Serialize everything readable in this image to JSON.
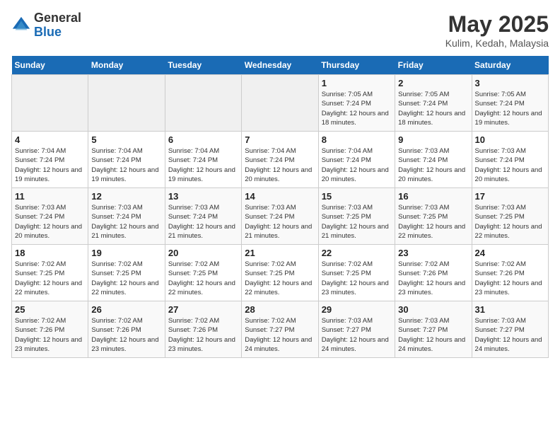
{
  "logo": {
    "general": "General",
    "blue": "Blue"
  },
  "title": "May 2025",
  "subtitle": "Kulim, Kedah, Malaysia",
  "headers": [
    "Sunday",
    "Monday",
    "Tuesday",
    "Wednesday",
    "Thursday",
    "Friday",
    "Saturday"
  ],
  "weeks": [
    [
      {
        "day": "",
        "sunrise": "",
        "sunset": "",
        "daylight": ""
      },
      {
        "day": "",
        "sunrise": "",
        "sunset": "",
        "daylight": ""
      },
      {
        "day": "",
        "sunrise": "",
        "sunset": "",
        "daylight": ""
      },
      {
        "day": "",
        "sunrise": "",
        "sunset": "",
        "daylight": ""
      },
      {
        "day": "1",
        "sunrise": "Sunrise: 7:05 AM",
        "sunset": "Sunset: 7:24 PM",
        "daylight": "Daylight: 12 hours and 18 minutes."
      },
      {
        "day": "2",
        "sunrise": "Sunrise: 7:05 AM",
        "sunset": "Sunset: 7:24 PM",
        "daylight": "Daylight: 12 hours and 18 minutes."
      },
      {
        "day": "3",
        "sunrise": "Sunrise: 7:05 AM",
        "sunset": "Sunset: 7:24 PM",
        "daylight": "Daylight: 12 hours and 19 minutes."
      }
    ],
    [
      {
        "day": "4",
        "sunrise": "Sunrise: 7:04 AM",
        "sunset": "Sunset: 7:24 PM",
        "daylight": "Daylight: 12 hours and 19 minutes."
      },
      {
        "day": "5",
        "sunrise": "Sunrise: 7:04 AM",
        "sunset": "Sunset: 7:24 PM",
        "daylight": "Daylight: 12 hours and 19 minutes."
      },
      {
        "day": "6",
        "sunrise": "Sunrise: 7:04 AM",
        "sunset": "Sunset: 7:24 PM",
        "daylight": "Daylight: 12 hours and 19 minutes."
      },
      {
        "day": "7",
        "sunrise": "Sunrise: 7:04 AM",
        "sunset": "Sunset: 7:24 PM",
        "daylight": "Daylight: 12 hours and 20 minutes."
      },
      {
        "day": "8",
        "sunrise": "Sunrise: 7:04 AM",
        "sunset": "Sunset: 7:24 PM",
        "daylight": "Daylight: 12 hours and 20 minutes."
      },
      {
        "day": "9",
        "sunrise": "Sunrise: 7:03 AM",
        "sunset": "Sunset: 7:24 PM",
        "daylight": "Daylight: 12 hours and 20 minutes."
      },
      {
        "day": "10",
        "sunrise": "Sunrise: 7:03 AM",
        "sunset": "Sunset: 7:24 PM",
        "daylight": "Daylight: 12 hours and 20 minutes."
      }
    ],
    [
      {
        "day": "11",
        "sunrise": "Sunrise: 7:03 AM",
        "sunset": "Sunset: 7:24 PM",
        "daylight": "Daylight: 12 hours and 20 minutes."
      },
      {
        "day": "12",
        "sunrise": "Sunrise: 7:03 AM",
        "sunset": "Sunset: 7:24 PM",
        "daylight": "Daylight: 12 hours and 21 minutes."
      },
      {
        "day": "13",
        "sunrise": "Sunrise: 7:03 AM",
        "sunset": "Sunset: 7:24 PM",
        "daylight": "Daylight: 12 hours and 21 minutes."
      },
      {
        "day": "14",
        "sunrise": "Sunrise: 7:03 AM",
        "sunset": "Sunset: 7:24 PM",
        "daylight": "Daylight: 12 hours and 21 minutes."
      },
      {
        "day": "15",
        "sunrise": "Sunrise: 7:03 AM",
        "sunset": "Sunset: 7:25 PM",
        "daylight": "Daylight: 12 hours and 21 minutes."
      },
      {
        "day": "16",
        "sunrise": "Sunrise: 7:03 AM",
        "sunset": "Sunset: 7:25 PM",
        "daylight": "Daylight: 12 hours and 22 minutes."
      },
      {
        "day": "17",
        "sunrise": "Sunrise: 7:03 AM",
        "sunset": "Sunset: 7:25 PM",
        "daylight": "Daylight: 12 hours and 22 minutes."
      }
    ],
    [
      {
        "day": "18",
        "sunrise": "Sunrise: 7:02 AM",
        "sunset": "Sunset: 7:25 PM",
        "daylight": "Daylight: 12 hours and 22 minutes."
      },
      {
        "day": "19",
        "sunrise": "Sunrise: 7:02 AM",
        "sunset": "Sunset: 7:25 PM",
        "daylight": "Daylight: 12 hours and 22 minutes."
      },
      {
        "day": "20",
        "sunrise": "Sunrise: 7:02 AM",
        "sunset": "Sunset: 7:25 PM",
        "daylight": "Daylight: 12 hours and 22 minutes."
      },
      {
        "day": "21",
        "sunrise": "Sunrise: 7:02 AM",
        "sunset": "Sunset: 7:25 PM",
        "daylight": "Daylight: 12 hours and 22 minutes."
      },
      {
        "day": "22",
        "sunrise": "Sunrise: 7:02 AM",
        "sunset": "Sunset: 7:25 PM",
        "daylight": "Daylight: 12 hours and 23 minutes."
      },
      {
        "day": "23",
        "sunrise": "Sunrise: 7:02 AM",
        "sunset": "Sunset: 7:26 PM",
        "daylight": "Daylight: 12 hours and 23 minutes."
      },
      {
        "day": "24",
        "sunrise": "Sunrise: 7:02 AM",
        "sunset": "Sunset: 7:26 PM",
        "daylight": "Daylight: 12 hours and 23 minutes."
      }
    ],
    [
      {
        "day": "25",
        "sunrise": "Sunrise: 7:02 AM",
        "sunset": "Sunset: 7:26 PM",
        "daylight": "Daylight: 12 hours and 23 minutes."
      },
      {
        "day": "26",
        "sunrise": "Sunrise: 7:02 AM",
        "sunset": "Sunset: 7:26 PM",
        "daylight": "Daylight: 12 hours and 23 minutes."
      },
      {
        "day": "27",
        "sunrise": "Sunrise: 7:02 AM",
        "sunset": "Sunset: 7:26 PM",
        "daylight": "Daylight: 12 hours and 23 minutes."
      },
      {
        "day": "28",
        "sunrise": "Sunrise: 7:02 AM",
        "sunset": "Sunset: 7:27 PM",
        "daylight": "Daylight: 12 hours and 24 minutes."
      },
      {
        "day": "29",
        "sunrise": "Sunrise: 7:03 AM",
        "sunset": "Sunset: 7:27 PM",
        "daylight": "Daylight: 12 hours and 24 minutes."
      },
      {
        "day": "30",
        "sunrise": "Sunrise: 7:03 AM",
        "sunset": "Sunset: 7:27 PM",
        "daylight": "Daylight: 12 hours and 24 minutes."
      },
      {
        "day": "31",
        "sunrise": "Sunrise: 7:03 AM",
        "sunset": "Sunset: 7:27 PM",
        "daylight": "Daylight: 12 hours and 24 minutes."
      }
    ]
  ]
}
